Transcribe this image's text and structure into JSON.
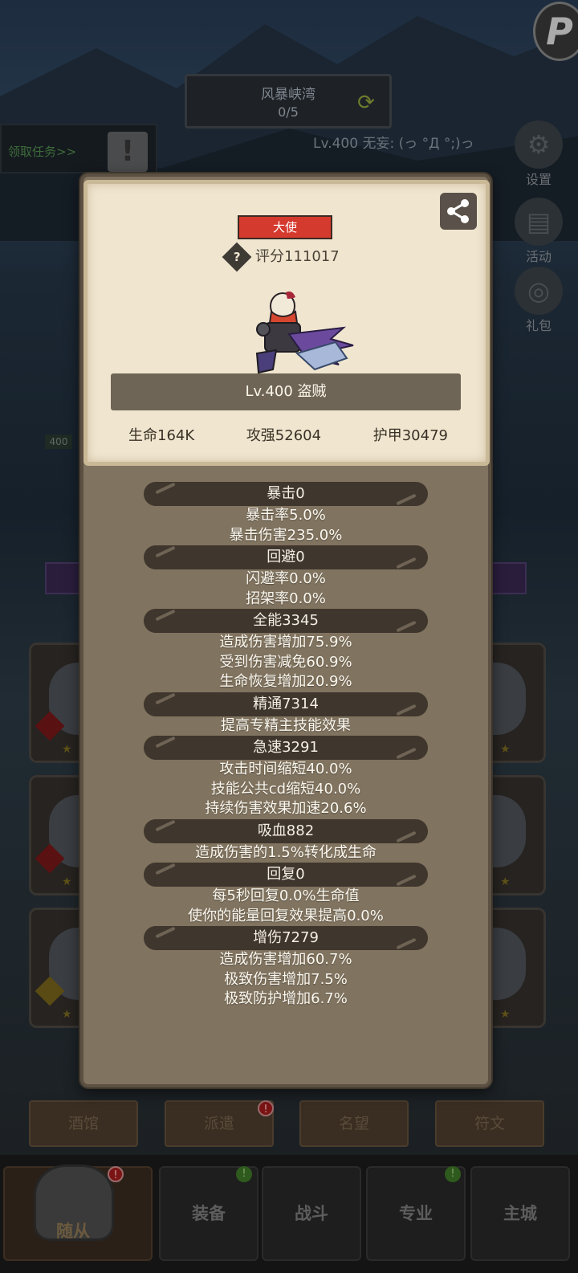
{
  "background": {
    "map_name": "风暴峡湾",
    "map_progress": "0/5",
    "quest_tab": "领取任务>>",
    "player_status": "Lv.400 无妄: (っ °Д °;)っ",
    "side_buttons": [
      "设置",
      "活动",
      "礼包"
    ],
    "level_tag": "400",
    "tabs": [
      "酒馆",
      "派遣",
      "名望",
      "符文"
    ],
    "nav": [
      "随从",
      "装备",
      "战斗",
      "专业",
      "主城"
    ],
    "alert_mark": "!"
  },
  "popup": {
    "rank_badge": "大使",
    "score_icon": "?",
    "score": "评分111017",
    "hero_name": "Lv.400 盗贼",
    "base_stats": {
      "hp": "生命164K",
      "attack": "攻强52604",
      "armor": "护甲30479"
    },
    "stat_groups": [
      {
        "header": "暴击0",
        "lines": [
          "暴击率5.0%",
          "暴击伤害235.0%"
        ]
      },
      {
        "header": "回避0",
        "lines": [
          "闪避率0.0%",
          "招架率0.0%"
        ]
      },
      {
        "header": "全能3345",
        "lines": [
          "造成伤害增加75.9%",
          "受到伤害减免60.9%",
          "生命恢复增加20.9%"
        ]
      },
      {
        "header": "精通7314",
        "lines": [
          "提高专精主技能效果"
        ]
      },
      {
        "header": "急速3291",
        "lines": [
          "攻击时间缩短40.0%",
          "技能公共cd缩短40.0%",
          "持续伤害效果加速20.6%"
        ]
      },
      {
        "header": "吸血882",
        "lines": [
          "造成伤害的1.5%转化成生命"
        ]
      },
      {
        "header": "回复0",
        "lines": [
          "每5秒回复0.0%生命值",
          "使你的能量回复效果提高0.0%"
        ]
      },
      {
        "header": "增伤7279",
        "lines": [
          "造成伤害增加60.7%",
          "极致伤害增加7.5%",
          "极致防护增加6.7%"
        ]
      }
    ]
  },
  "colors": {
    "badge_red": "#d53a2e",
    "panel_parchment": "#f0e6d0",
    "popup_brown": "#80735f",
    "stat_header_dark": "#3f362d"
  }
}
